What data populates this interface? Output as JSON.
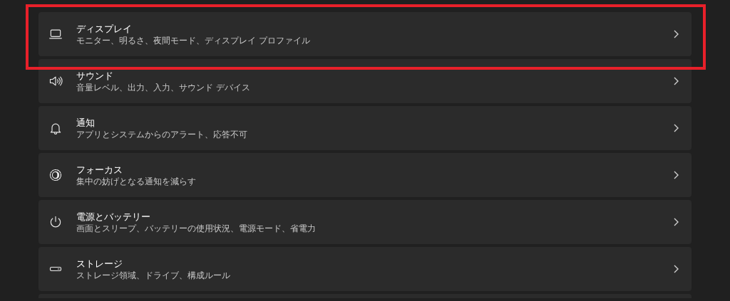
{
  "settings_items": [
    {
      "title": "ディスプレイ",
      "description": "モニター、明るさ、夜間モード、ディスプレイ プロファイル",
      "highlighted": true
    },
    {
      "title": "サウンド",
      "description": "音量レベル、出力、入力、サウンド デバイス",
      "highlighted": false
    },
    {
      "title": "通知",
      "description": "アプリとシステムからのアラート、応答不可",
      "highlighted": false
    },
    {
      "title": "フォーカス",
      "description": "集中の妨げとなる通知を減らす",
      "highlighted": false
    },
    {
      "title": "電源とバッテリー",
      "description": "画面とスリープ、バッテリーの使用状況、電源モード、省電力",
      "highlighted": false
    },
    {
      "title": "ストレージ",
      "description": "ストレージ領域、ドライブ、構成ルール",
      "highlighted": false
    }
  ]
}
